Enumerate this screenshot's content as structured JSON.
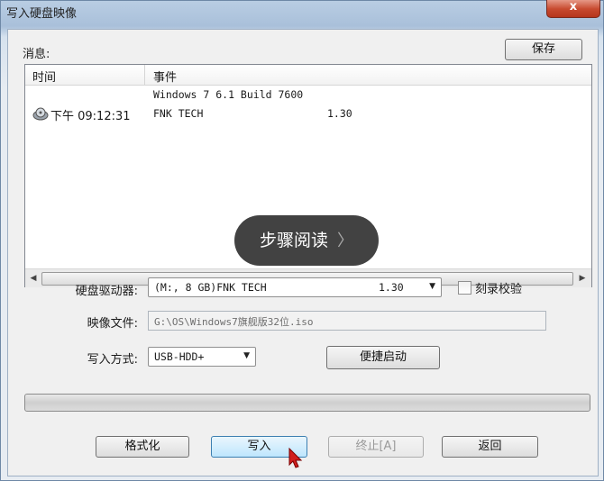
{
  "window": {
    "title": "写入硬盘映像",
    "close_label": "x"
  },
  "messages": {
    "label": "消息:",
    "save_button": "保存",
    "columns": {
      "time": "时间",
      "event": "事件"
    },
    "rows": [
      {
        "time": "",
        "event": "Windows 7 6.1 Build 7600"
      },
      {
        "time": "下午 09:12:31",
        "event": "FNK TECH",
        "version": "1.30"
      }
    ]
  },
  "overlay": {
    "label": "步骤阅读",
    "chevron": "〉"
  },
  "form": {
    "drive_label": "硬盘驱动器:",
    "drive_value": "(M:, 8 GB)FNK TECH",
    "drive_version": "1.30",
    "verify_label": "刻录校验",
    "verify_checked": false,
    "image_label": "映像文件:",
    "image_value": "G:\\OS\\Windows7旗舰版32位.iso",
    "mode_label": "写入方式:",
    "mode_value": "USB-HDD+",
    "boot_button": "便捷启动"
  },
  "progress": {
    "value": 0
  },
  "buttons": {
    "format": "格式化",
    "write": "写入",
    "stop": "终止[A]",
    "back": "返回"
  },
  "colors": {
    "progress_fill": "#37b44a",
    "close_button": "#c74a2f"
  }
}
